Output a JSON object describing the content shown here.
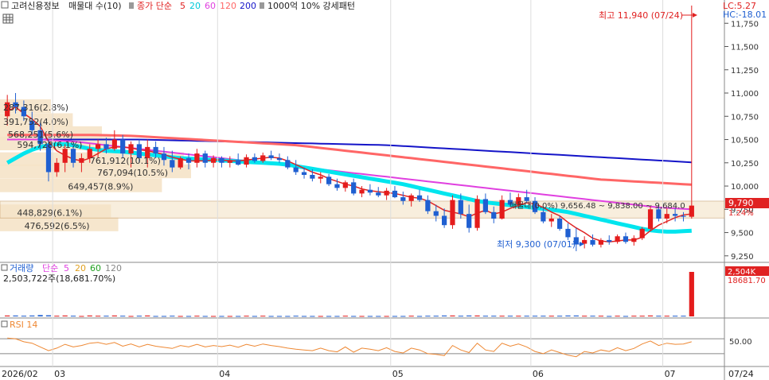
{
  "header": {
    "stock": "고려신용정보",
    "indicator": "매물대 수(10)",
    "price_ma_label": "종가 단순",
    "ma_periods": [
      "5",
      "20",
      "60",
      "120",
      "200"
    ],
    "extra_label": "1000억 10% 강세패턴",
    "lc_label": "LC:5.27",
    "hc_label": "HC:-18.01"
  },
  "colors": {
    "up": "#e41c1c",
    "down": "#1f5fd1",
    "ma5": "#e02222",
    "ma20": "#00e5ee",
    "ma60": "#e040e0",
    "ma120": "#ff6666",
    "ma200": "#1414c8",
    "volume_profile": "#f5e3c8",
    "rsi": "#ee8833"
  },
  "price_axis": {
    "ticks": [
      "11,750",
      "11,500",
      "11,250",
      "11,000",
      "10,750",
      "10,500",
      "10,250",
      "10,000",
      "9,750",
      "9,500",
      "9,250"
    ],
    "current_price": "9,790",
    "current_change": "1.24%"
  },
  "annotations": {
    "high": "최고 11,940 (07/24)",
    "low": "최저 9,300 (07/01)",
    "band_text": "매물대(0.0%) 9,656.48 ~ 9,838.00 ~ 9,684.0"
  },
  "volume_profile_labels": [
    "287,316(2.8%)",
    "391,752(4.0%)",
    "568,251(5.6%)",
    "594,728(6.1%)",
    "761,912(10.1%)",
    "767,094(10.5%)",
    "649,457(8.9%)",
    "448,829(6.1%)",
    "476,592(6.5%)"
  ],
  "volume_panel": {
    "title": "거래량",
    "ma_label": "단순",
    "ma_periods": [
      "5",
      "20",
      "60",
      "120"
    ],
    "last_value_text": "2,503,722주(18,681.70%)",
    "axis_value": "2,504K",
    "axis_pct": "18681.70"
  },
  "rsi_panel": {
    "title": "RSI 14",
    "axis_tick": "50.00"
  },
  "x_axis": {
    "labels": [
      "2026/02",
      "03",
      "04",
      "05",
      "06",
      "07"
    ],
    "last_date": "07/24"
  },
  "chart_data": {
    "type": "candlestick",
    "ylim": [
      9180,
      12000
    ],
    "ohlc": [
      [
        10750,
        10980,
        10650,
        10900
      ],
      [
        10900,
        11000,
        10780,
        10850
      ],
      [
        10850,
        10920,
        10700,
        10750
      ],
      [
        10700,
        10800,
        10550,
        10600
      ],
      [
        10600,
        10680,
        10380,
        10450
      ],
      [
        10450,
        10500,
        10050,
        10150
      ],
      [
        10150,
        10300,
        10100,
        10250
      ],
      [
        10250,
        10450,
        10150,
        10400
      ],
      [
        10400,
        10450,
        10200,
        10250
      ],
      [
        10250,
        10350,
        10150,
        10300
      ],
      [
        10300,
        10450,
        10250,
        10400
      ],
      [
        10400,
        10500,
        10300,
        10450
      ],
      [
        10450,
        10520,
        10350,
        10400
      ],
      [
        10400,
        10600,
        10380,
        10500
      ],
      [
        10500,
        10550,
        10300,
        10350
      ],
      [
        10350,
        10480,
        10200,
        10450
      ],
      [
        10450,
        10500,
        10250,
        10300
      ],
      [
        10300,
        10500,
        10200,
        10420
      ],
      [
        10420,
        10480,
        10300,
        10350
      ],
      [
        10350,
        10420,
        10220,
        10280
      ],
      [
        10280,
        10380,
        10150,
        10200
      ],
      [
        10200,
        10320,
        10180,
        10300
      ],
      [
        10300,
        10350,
        10180,
        10250
      ],
      [
        10250,
        10400,
        10200,
        10350
      ],
      [
        10350,
        10380,
        10200,
        10250
      ],
      [
        10250,
        10330,
        10200,
        10300
      ],
      [
        10300,
        10320,
        10200,
        10250
      ],
      [
        10250,
        10320,
        10200,
        10280
      ],
      [
        10280,
        10350,
        10220,
        10230
      ],
      [
        10230,
        10340,
        10200,
        10310
      ],
      [
        10310,
        10350,
        10250,
        10270
      ],
      [
        10270,
        10360,
        10250,
        10330
      ],
      [
        10330,
        10380,
        10280,
        10300
      ],
      [
        10300,
        10350,
        10250,
        10280
      ],
      [
        10280,
        10320,
        10180,
        10200
      ],
      [
        10200,
        10280,
        10120,
        10150
      ],
      [
        10150,
        10200,
        10080,
        10120
      ],
      [
        10120,
        10180,
        10050,
        10080
      ],
      [
        10080,
        10150,
        10030,
        10100
      ],
      [
        10100,
        10130,
        10000,
        10020
      ],
      [
        10020,
        10080,
        9950,
        9980
      ],
      [
        9980,
        10060,
        9940,
        10040
      ],
      [
        10040,
        10080,
        9900,
        9920
      ],
      [
        9920,
        10000,
        9880,
        9960
      ],
      [
        9960,
        10020,
        9900,
        9930
      ],
      [
        9930,
        9990,
        9880,
        9900
      ],
      [
        9900,
        9980,
        9850,
        9950
      ],
      [
        9950,
        10000,
        9870,
        9880
      ],
      [
        9880,
        9940,
        9800,
        9840
      ],
      [
        9840,
        9920,
        9780,
        9900
      ],
      [
        9900,
        9960,
        9830,
        9850
      ],
      [
        9850,
        9900,
        9700,
        9730
      ],
      [
        9730,
        9800,
        9620,
        9680
      ],
      [
        9680,
        9760,
        9550,
        9580
      ],
      [
        9580,
        9900,
        9540,
        9850
      ],
      [
        9850,
        9920,
        9650,
        9700
      ],
      [
        9700,
        9800,
        9500,
        9550
      ],
      [
        9550,
        9900,
        9520,
        9860
      ],
      [
        9860,
        9920,
        9700,
        9720
      ],
      [
        9720,
        9780,
        9600,
        9650
      ],
      [
        9650,
        9900,
        9640,
        9850
      ],
      [
        9850,
        9930,
        9780,
        9800
      ],
      [
        9800,
        9920,
        9760,
        9880
      ],
      [
        9880,
        9960,
        9820,
        9840
      ],
      [
        9840,
        9880,
        9700,
        9720
      ],
      [
        9720,
        9760,
        9600,
        9620
      ],
      [
        9620,
        9700,
        9560,
        9650
      ],
      [
        9650,
        9680,
        9520,
        9540
      ],
      [
        9540,
        9600,
        9420,
        9450
      ],
      [
        9450,
        9550,
        9300,
        9380
      ],
      [
        9380,
        9460,
        9330,
        9420
      ],
      [
        9420,
        9480,
        9350,
        9370
      ],
      [
        9370,
        9440,
        9340,
        9420
      ],
      [
        9420,
        9470,
        9370,
        9400
      ],
      [
        9400,
        9480,
        9380,
        9460
      ],
      [
        9460,
        9500,
        9380,
        9400
      ],
      [
        9400,
        9470,
        9360,
        9440
      ],
      [
        9440,
        9560,
        9420,
        9540
      ],
      [
        9540,
        9780,
        9520,
        9750
      ],
      [
        9750,
        9800,
        9620,
        9650
      ],
      [
        9650,
        9760,
        9600,
        9700
      ],
      [
        9700,
        9760,
        9620,
        9680
      ],
      [
        9680,
        9720,
        9620,
        9670
      ],
      [
        9670,
        11940,
        9650,
        9790
      ]
    ],
    "ma5": [
      10800,
      10850,
      10780,
      10720,
      10640,
      10480,
      10380,
      10330,
      10290,
      10270,
      10300,
      10350,
      10400,
      10420,
      10420,
      10410,
      10390,
      10380,
      10360,
      10340,
      10310,
      10290,
      10270,
      10270,
      10270,
      10280,
      10280,
      10270,
      10270,
      10280,
      10290,
      10300,
      10310,
      10300,
      10270,
      10230,
      10190,
      10150,
      10120,
      10080,
      10050,
      10020,
      10000,
      9970,
      9950,
      9940,
      9930,
      9920,
      9900,
      9880,
      9870,
      9840,
      9790,
      9740,
      9720,
      9700,
      9670,
      9710,
      9740,
      9700,
      9720,
      9760,
      9790,
      9820,
      9810,
      9770,
      9720,
      9680,
      9610,
      9550,
      9500,
      9440,
      9410,
      9400,
      9410,
      9420,
      9420,
      9450,
      9520,
      9580,
      9620,
      9660,
      9690,
      9700
    ],
    "ma20": [
      10250,
      10300,
      10350,
      10390,
      10420,
      10440,
      10450,
      10450,
      10440,
      10420,
      10400,
      10390,
      10380,
      10375,
      10370,
      10360,
      10350,
      10340,
      10330,
      10320,
      10310,
      10300,
      10295,
      10290,
      10285,
      10280,
      10275,
      10270,
      10265,
      10260,
      10255,
      10250,
      10245,
      10240,
      10230,
      10215,
      10200,
      10185,
      10170,
      10155,
      10140,
      10125,
      10110,
      10095,
      10080,
      10065,
      10050,
      10035,
      10020,
      10000,
      9980,
      9960,
      9940,
      9920,
      9900,
      9880,
      9860,
      9840,
      9825,
      9815,
      9805,
      9795,
      9785,
      9775,
      9765,
      9755,
      9745,
      9735,
      9720,
      9700,
      9680,
      9660,
      9640,
      9620,
      9600,
      9580,
      9560,
      9540,
      9525,
      9515,
      9510,
      9510,
      9515,
      9520
    ],
    "ma60": [
      10500,
      10500,
      10500,
      10500,
      10500,
      10495,
      10490,
      10485,
      10480,
      10470,
      10460,
      10450,
      10440,
      10430,
      10420,
      10410,
      10400,
      10390,
      10380,
      10370,
      10360,
      10350,
      10340,
      10330,
      10320,
      10310,
      10300,
      10290,
      10280,
      10270,
      10260,
      10250,
      10240,
      10230,
      10220,
      10210,
      10200,
      10190,
      10180,
      10170,
      10160,
      10150,
      10140,
      10130,
      10120,
      10110,
      10100,
      10090,
      10080,
      10070,
      10060,
      10050,
      10040,
      10030,
      10020,
      10010,
      10000,
      9990,
      9980,
      9970,
      9960,
      9950,
      9940,
      9930,
      9920,
      9910,
      9900,
      9890,
      9880,
      9870,
      9860,
      9850,
      9840,
      9830,
      9820,
      9810,
      9800,
      9790,
      9780,
      9770,
      9765,
      9760,
      9755,
      9750
    ],
    "ma120": [
      10550,
      10550,
      10550,
      10550,
      10550,
      10550,
      10550,
      10550,
      10550,
      10550,
      10550,
      10548,
      10546,
      10544,
      10542,
      10540,
      10535,
      10530,
      10525,
      10520,
      10515,
      10510,
      10505,
      10500,
      10495,
      10490,
      10485,
      10480,
      10475,
      10470,
      10465,
      10460,
      10455,
      10450,
      10445,
      10440,
      10430,
      10420,
      10410,
      10400,
      10390,
      10380,
      10370,
      10360,
      10350,
      10340,
      10330,
      10320,
      10310,
      10300,
      10290,
      10280,
      10270,
      10260,
      10250,
      10240,
      10230,
      10220,
      10210,
      10200,
      10190,
      10180,
      10170,
      10160,
      10150,
      10140,
      10130,
      10120,
      10110,
      10100,
      10090,
      10080,
      10070,
      10065,
      10060,
      10055,
      10050,
      10045,
      10040,
      10035,
      10030,
      10025,
      10020,
      10015
    ],
    "ma200": [
      10500,
      10500,
      10500,
      10500,
      10500,
      10500,
      10500,
      10500,
      10500,
      10500,
      10500,
      10500,
      10500,
      10500,
      10500,
      10500,
      10500,
      10498,
      10496,
      10494,
      10492,
      10490,
      10488,
      10486,
      10484,
      10482,
      10480,
      10478,
      10476,
      10474,
      10472,
      10470,
      10468,
      10466,
      10464,
      10462,
      10460,
      10458,
      10456,
      10454,
      10452,
      10450,
      10448,
      10446,
      10444,
      10442,
      10440,
      10435,
      10430,
      10425,
      10420,
      10415,
      10410,
      10405,
      10400,
      10395,
      10390,
      10385,
      10380,
      10375,
      10370,
      10365,
      10360,
      10355,
      10350,
      10345,
      10340,
      10335,
      10330,
      10325,
      10320,
      10315,
      10310,
      10305,
      10300,
      10295,
      10290,
      10285,
      10280,
      10275,
      10270,
      10265,
      10260,
      10255
    ],
    "volume": [
      0.02,
      0.02,
      0.015,
      0.02,
      0.03,
      0.025,
      0.015,
      0.02,
      0.015,
      0.01,
      0.02,
      0.015,
      0.015,
      0.02,
      0.015,
      0.01,
      0.015,
      0.02,
      0.01,
      0.01,
      0.015,
      0.01,
      0.01,
      0.015,
      0.01,
      0.01,
      0.01,
      0.01,
      0.01,
      0.015,
      0.01,
      0.015,
      0.01,
      0.01,
      0.01,
      0.015,
      0.01,
      0.01,
      0.01,
      0.01,
      0.01,
      0.015,
      0.01,
      0.01,
      0.01,
      0.01,
      0.01,
      0.01,
      0.01,
      0.015,
      0.01,
      0.015,
      0.015,
      0.02,
      0.02,
      0.015,
      0.02,
      0.02,
      0.015,
      0.015,
      0.015,
      0.015,
      0.015,
      0.015,
      0.015,
      0.015,
      0.015,
      0.015,
      0.02,
      0.02,
      0.015,
      0.015,
      0.015,
      0.01,
      0.015,
      0.01,
      0.015,
      0.015,
      0.02,
      0.015,
      0.015,
      0.015,
      0.015,
      1.0
    ],
    "rsi": [
      72,
      70,
      62,
      58,
      48,
      38,
      45,
      55,
      48,
      52,
      58,
      60,
      55,
      60,
      50,
      56,
      48,
      55,
      50,
      47,
      44,
      52,
      48,
      55,
      48,
      52,
      49,
      53,
      47,
      55,
      50,
      56,
      52,
      49,
      45,
      42,
      40,
      38,
      45,
      38,
      35,
      48,
      34,
      45,
      42,
      38,
      46,
      36,
      32,
      45,
      40,
      30,
      28,
      25,
      52,
      40,
      33,
      58,
      40,
      36,
      58,
      50,
      56,
      48,
      36,
      30,
      40,
      33,
      26,
      22,
      36,
      32,
      40,
      36,
      46,
      38,
      44,
      56,
      64,
      52,
      58,
      55,
      56,
      62
    ]
  }
}
